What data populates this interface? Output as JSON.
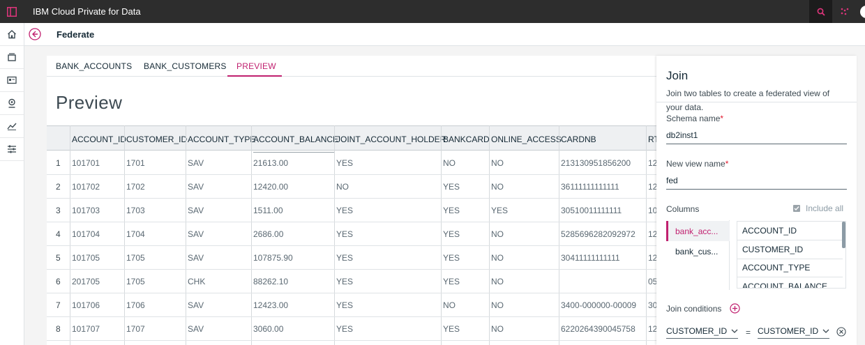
{
  "topbar": {
    "app_title": "IBM Cloud Private for Data",
    "icons": [
      "sidebar-toggle-icon",
      "search-icon",
      "apps-icon"
    ],
    "accent_color": "#e0357c"
  },
  "leftnav": {
    "icons": [
      "home-icon",
      "collect-icon",
      "organize-icon",
      "analyze-icon",
      "dashboard-icon",
      "admin-icon"
    ]
  },
  "header": {
    "title": "Federate"
  },
  "tabs": [
    {
      "label": "BANK_ACCOUNTS",
      "active": false
    },
    {
      "label": "BANK_CUSTOMERS",
      "active": false
    },
    {
      "label": "PREVIEW",
      "active": true
    }
  ],
  "preview": {
    "title": "Preview",
    "columns": [
      "ACCOUNT_ID",
      "CUSTOMER_ID",
      "ACCOUNT_TYPE",
      "ACCOUNT_BALANCE",
      "JOINT_ACCOUNT_HOLDER",
      "BANKCARD",
      "ONLINE_ACCESS",
      "CARDNB",
      "RT"
    ],
    "rows": [
      [
        "1",
        "101701",
        "1701",
        "SAV",
        "21613.00",
        "YES",
        "NO",
        "NO",
        "213130951856200",
        "12"
      ],
      [
        "2",
        "101702",
        "1702",
        "SAV",
        "12420.00",
        "NO",
        "YES",
        "NO",
        "36111111111111",
        "12"
      ],
      [
        "3",
        "101703",
        "1703",
        "SAV",
        "1511.00",
        "YES",
        "YES",
        "YES",
        "30510011111111",
        "10"
      ],
      [
        "4",
        "101704",
        "1704",
        "SAV",
        "2686.00",
        "YES",
        "YES",
        "NO",
        "5285696282092972",
        "12"
      ],
      [
        "5",
        "101705",
        "1705",
        "SAV",
        "107875.90",
        "YES",
        "YES",
        "NO",
        "30411111111111",
        "12"
      ],
      [
        "6",
        "201705",
        "1705",
        "CHK",
        "88262.10",
        "YES",
        "YES",
        "NO",
        "",
        "05"
      ],
      [
        "7",
        "101706",
        "1706",
        "SAV",
        "12423.00",
        "YES",
        "NO",
        "NO",
        "3400-000000-00009",
        "30"
      ],
      [
        "8",
        "101707",
        "1707",
        "SAV",
        "3060.00",
        "YES",
        "YES",
        "NO",
        "6220264390045758",
        "12"
      ]
    ]
  },
  "join_panel": {
    "title": "Join",
    "description": "Join two tables to create a federated view of your data.",
    "schema_label": "Schema name",
    "schema_value": "db2inst1",
    "view_label": "New view name",
    "view_value": "fed",
    "required_mark": "*",
    "columns_label": "Columns",
    "include_all_label": "Include all",
    "tables": [
      "bank_acc...",
      "bank_cus..."
    ],
    "column_items": [
      "ACCOUNT_ID",
      "CUSTOMER_ID",
      "ACCOUNT_TYPE",
      "ACCOUNT_BALANCE"
    ],
    "join_conditions_label": "Join conditions",
    "left_column": "CUSTOMER_ID",
    "operator": "=",
    "right_column": "CUSTOMER_ID"
  }
}
